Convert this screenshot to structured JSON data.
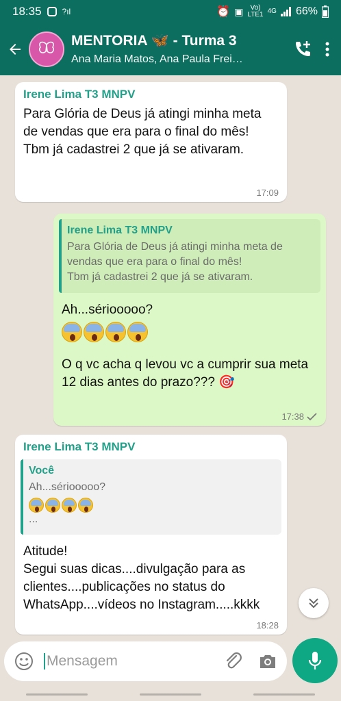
{
  "status_bar": {
    "time": "18:35",
    "network_top": "Vo)",
    "network_bottom": "LTE1",
    "signal": "4G",
    "battery": "66%"
  },
  "header": {
    "title": "MENTORIA 🦋 - Turma 3",
    "subtitle": "Ana Maria Matos, Ana Paula Frei…"
  },
  "messages": [
    {
      "sender": "Irene Lima T3 MNPV",
      "text": "Para Glória de Deus já atingi minha meta de vendas que era para o final do mês!\nTbm já cadastrei 2 que já  se ativaram.",
      "time": "17:09"
    },
    {
      "quote_sender": "Irene Lima T3 MNPV",
      "quote_text": "Para Glória de Deus já atingi minha meta de vendas que era para o final do mês!\nTbm já cadastrei 2 que já  se ativaram.",
      "text_1": "Ah...sériooooo?",
      "text_2": "O q vc acha q levou vc a cumprir sua meta 12 dias antes do prazo??? 🎯",
      "time": "17:38"
    },
    {
      "sender": "Irene Lima T3 MNPV",
      "quote_sender": "Você",
      "quote_text": "Ah...sériooooo?",
      "quote_more": "...",
      "text": "Atitude!\nSegui suas dicas....divulgação para as clientes....publicações no status do WhatsApp....vídeos no Instagram.....kkkk",
      "time": "18:28"
    }
  ],
  "input": {
    "placeholder": "Mensagem"
  },
  "colors": {
    "header": "#0b6e5f",
    "accent": "#23a089",
    "outgoing_bubble": "#dcf8c6",
    "mic": "#0fa884"
  }
}
